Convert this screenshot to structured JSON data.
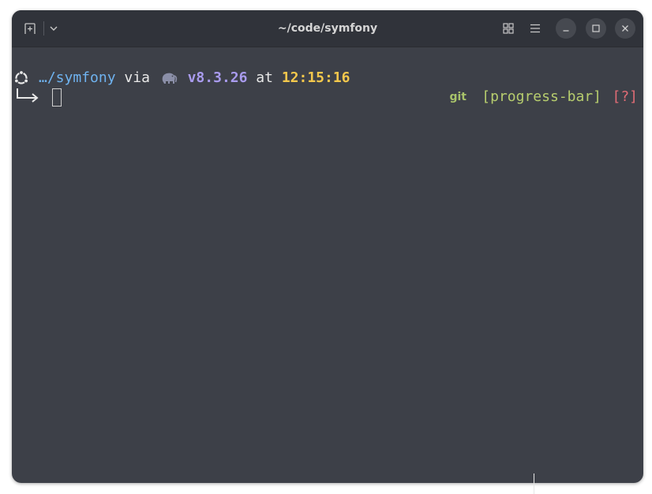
{
  "window": {
    "title": "~/code/symfony"
  },
  "prompt": {
    "path": "…/symfony",
    "via": "via",
    "version": "v8.3.26",
    "at": "at",
    "time": "12:15:16",
    "git_label": "git",
    "git_branch": "[progress-bar]",
    "git_status": "[?]"
  },
  "icons": {
    "os": "ubuntu-icon",
    "php": "elephant-icon",
    "continuation": "arrow-return-icon"
  },
  "colors": {
    "path": "#6fb3f0",
    "version": "#a99bee",
    "time": "#f5c84c",
    "git_branch": "#b7cd6e",
    "git_status": "#e06c75",
    "terminal_bg": "#3d4048",
    "titlebar_bg": "#30333a"
  }
}
